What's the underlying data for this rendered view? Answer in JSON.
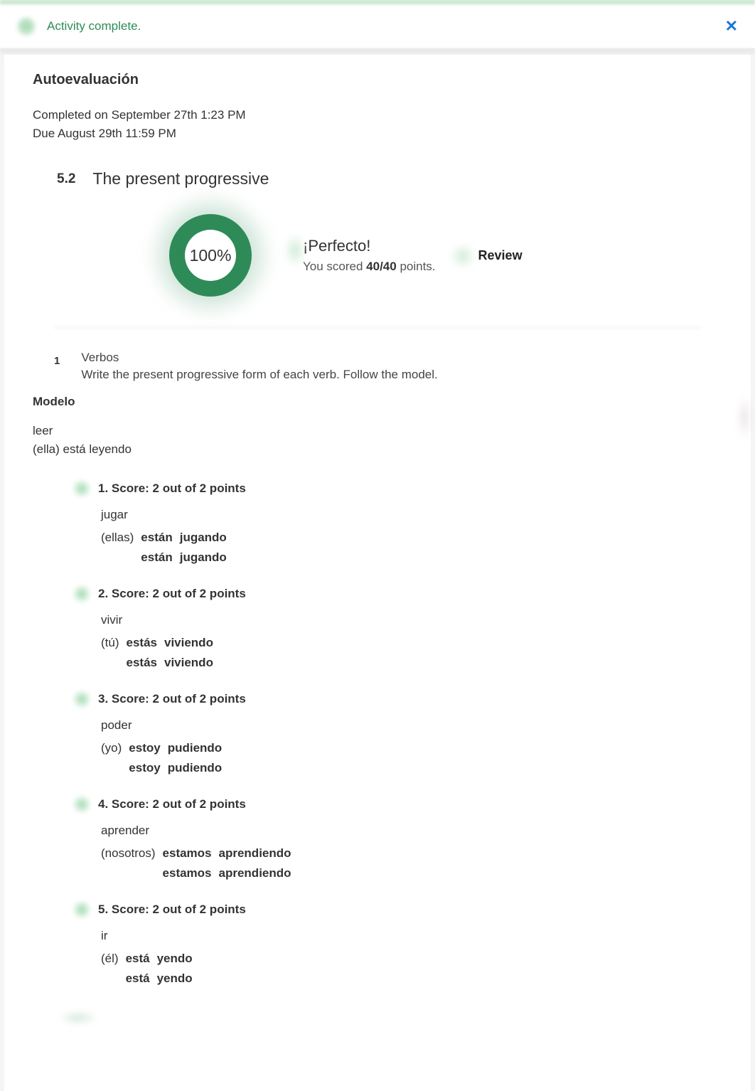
{
  "alert": {
    "text": "Activity complete."
  },
  "header": {
    "title": "Autoevaluación",
    "completed": "Completed on September 27th 1:23 PM",
    "due": "Due August 29th 11:59 PM"
  },
  "section": {
    "number": "5.2",
    "title": "The present progressive"
  },
  "score": {
    "percent": "100%",
    "perfecto": "¡Perfecto!",
    "scored_prefix": "You scored ",
    "scored_value": "40/40",
    "scored_suffix": " points.",
    "review": "Review"
  },
  "exercise": {
    "number": "1",
    "title": "Verbos",
    "instructions": "Write the present progressive form of each verb. Follow the model."
  },
  "modelo": {
    "label": "Modelo",
    "verb": "leer",
    "answer": "(ella) está leyendo"
  },
  "items": [
    {
      "score": "1. Score: 2 out of 2 points",
      "verb": "jugar",
      "pronoun": "(ellas)",
      "aux": "están",
      "ger": "jugando",
      "key_aux": "están",
      "key_ger": "jugando"
    },
    {
      "score": "2. Score: 2 out of 2 points",
      "verb": "vivir",
      "pronoun": "(tú)",
      "aux": "estás",
      "ger": "viviendo",
      "key_aux": "estás",
      "key_ger": "viviendo"
    },
    {
      "score": "3. Score: 2 out of 2 points",
      "verb": "poder",
      "pronoun": "(yo)",
      "aux": "estoy",
      "ger": "pudiendo",
      "key_aux": "estoy",
      "key_ger": "pudiendo"
    },
    {
      "score": "4. Score: 2 out of 2 points",
      "verb": "aprender",
      "pronoun": "(nosotros)",
      "aux": "estamos",
      "ger": "aprendiendo",
      "key_aux": "estamos",
      "key_ger": "aprendiendo"
    },
    {
      "score": "5. Score: 2 out of 2 points",
      "verb": "ir",
      "pronoun": "(él)",
      "aux": "está",
      "ger": "yendo",
      "key_aux": "está",
      "key_ger": "yendo"
    }
  ]
}
